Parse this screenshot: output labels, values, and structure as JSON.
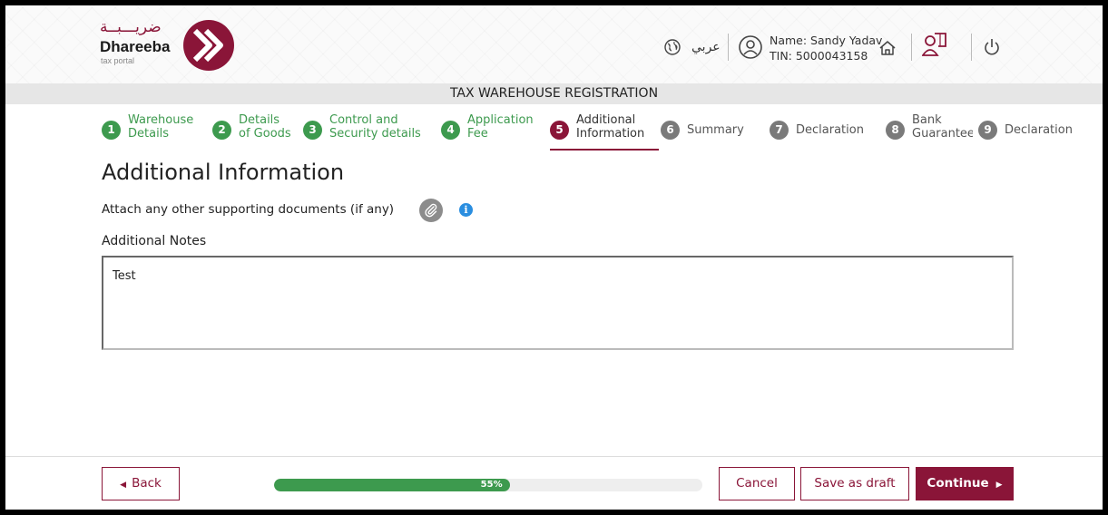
{
  "header": {
    "logo_arabic": "ضريـــبــة",
    "logo_english": "Dhareeba",
    "logo_sub": "tax portal",
    "language_label": "عربي",
    "user_name": "Name: Sandy Yadav",
    "user_tin": "TIN: 5000043158"
  },
  "page_title_bar": "TAX WAREHOUSE REGISTRATION",
  "stepper": [
    {
      "num": "1",
      "line1": "Warehouse",
      "line2": "Details",
      "state": "done"
    },
    {
      "num": "2",
      "line1": "Details",
      "line2": "of Goods",
      "state": "done"
    },
    {
      "num": "3",
      "line1": "Control and",
      "line2": "Security details",
      "state": "done"
    },
    {
      "num": "4",
      "line1": "Application",
      "line2": "Fee",
      "state": "done"
    },
    {
      "num": "5",
      "line1": "Additional",
      "line2": "Information",
      "state": "active"
    },
    {
      "num": "6",
      "line1": "Summary",
      "line2": "",
      "state": "todo"
    },
    {
      "num": "7",
      "line1": "Declaration",
      "line2": "",
      "state": "todo"
    },
    {
      "num": "8",
      "line1": "Bank",
      "line2": "Guarantee",
      "state": "todo"
    },
    {
      "num": "9",
      "line1": "Declaration",
      "line2": "",
      "state": "todo"
    }
  ],
  "main": {
    "title": "Additional Information",
    "attach_label": "Attach any other supporting documents (if any)",
    "notes_label": "Additional Notes",
    "notes_value": "Test"
  },
  "footer": {
    "back_label": "Back",
    "cancel_label": "Cancel",
    "draft_label": "Save as draft",
    "continue_label": "Continue",
    "progress_percent": 55,
    "progress_text": "55%"
  },
  "colors": {
    "brand": "#8a1538",
    "done": "#3d9a4e",
    "todo": "#7a7a7a",
    "info": "#2a8ee0"
  }
}
